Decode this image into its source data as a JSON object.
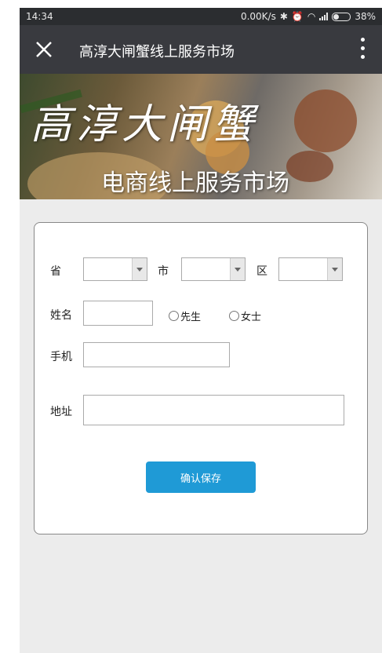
{
  "status_bar": {
    "time": "14:34",
    "speed": "0.00K/s",
    "battery": "38%",
    "icons": [
      "bluetooth-icon",
      "alarm-icon",
      "wifi-icon",
      "signal-icon",
      "battery-icon"
    ]
  },
  "nav": {
    "title": "高淳大闸蟹线上服务市场"
  },
  "banner": {
    "title": "高淳大闸蟹",
    "subtitle": "电商线上服务市场"
  },
  "form": {
    "province_label": "省",
    "city_label": "市",
    "district_label": "区",
    "name_label": "姓名",
    "mr_label": "先生",
    "ms_label": "女士",
    "phone_label": "手机",
    "address_label": "地址",
    "province_value": "",
    "city_value": "",
    "district_value": "",
    "name_value": "",
    "phone_value": "",
    "address_value": "",
    "submit_label": "确认保存"
  },
  "colors": {
    "accent": "#1f9ad6",
    "navbar": "#393a3f",
    "statusbar": "#2b2d30",
    "background": "#ececec"
  }
}
